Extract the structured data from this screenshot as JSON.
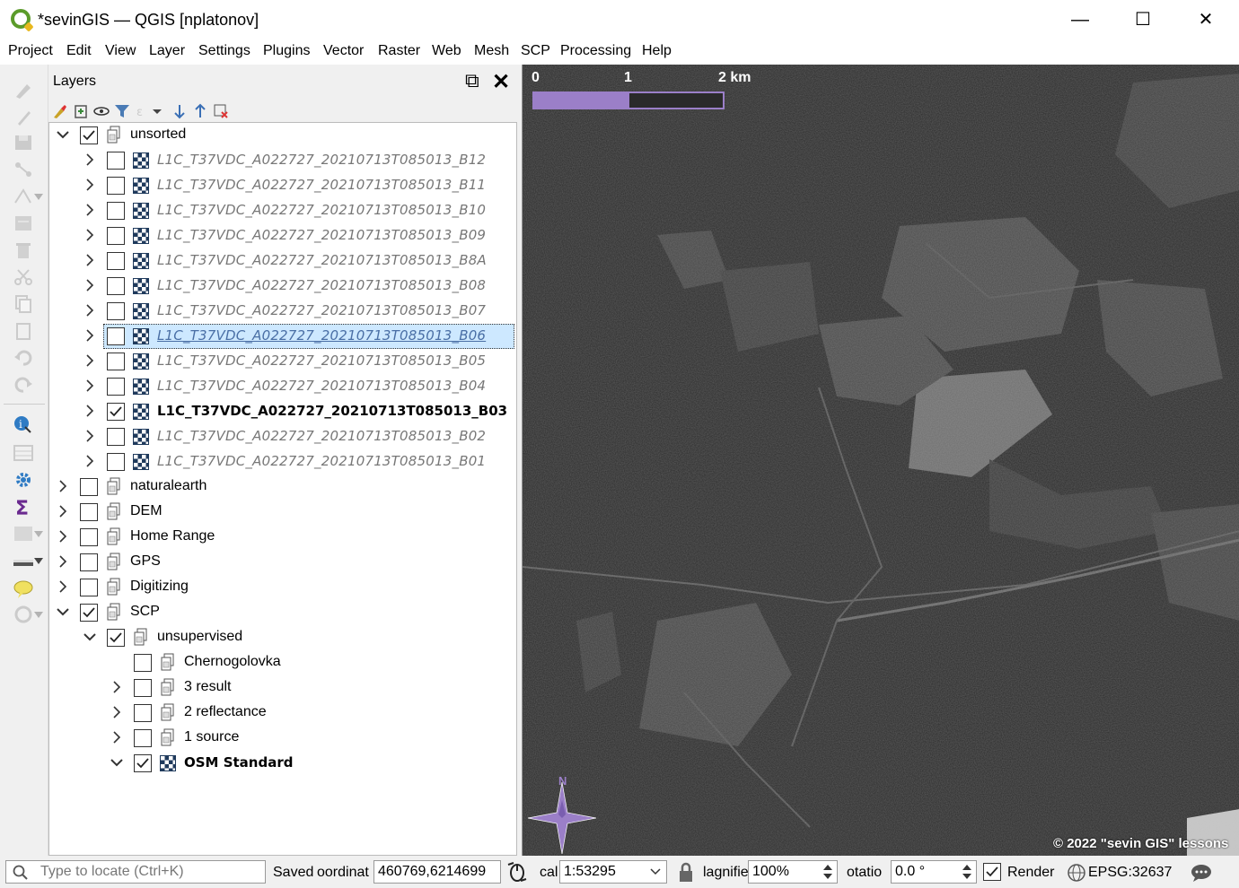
{
  "window": {
    "title": "*sevinGIS — QGIS [nplatonov]",
    "minimize": "—",
    "maximize": "☐",
    "close": "✕"
  },
  "menu": [
    "Project",
    "Edit",
    "View",
    "Layer",
    "Settings",
    "Plugins",
    "Vector",
    "Raster",
    "Web",
    "Mesh",
    "SCP",
    "Processing",
    "Help"
  ],
  "panel": {
    "title": "Layers",
    "float_button": "⧉",
    "close_button": "✕"
  },
  "tree": [
    {
      "label": "unsorted",
      "type": "group",
      "level": 0,
      "expand": "open",
      "checked": true
    },
    {
      "label": "L1C_T37VDC_A022727_20210713T085013_B12",
      "type": "raster",
      "level": 1,
      "expand": "closed",
      "checked": false,
      "style": "it"
    },
    {
      "label": "L1C_T37VDC_A022727_20210713T085013_B11",
      "type": "raster",
      "level": 1,
      "expand": "closed",
      "checked": false,
      "style": "it"
    },
    {
      "label": "L1C_T37VDC_A022727_20210713T085013_B10",
      "type": "raster",
      "level": 1,
      "expand": "closed",
      "checked": false,
      "style": "it"
    },
    {
      "label": "L1C_T37VDC_A022727_20210713T085013_B09",
      "type": "raster",
      "level": 1,
      "expand": "closed",
      "checked": false,
      "style": "it"
    },
    {
      "label": "L1C_T37VDC_A022727_20210713T085013_B8A",
      "type": "raster",
      "level": 1,
      "expand": "closed",
      "checked": false,
      "style": "it"
    },
    {
      "label": "L1C_T37VDC_A022727_20210713T085013_B08",
      "type": "raster",
      "level": 1,
      "expand": "closed",
      "checked": false,
      "style": "it"
    },
    {
      "label": "L1C_T37VDC_A022727_20210713T085013_B07",
      "type": "raster",
      "level": 1,
      "expand": "closed",
      "checked": false,
      "style": "it"
    },
    {
      "label": "L1C_T37VDC_A022727_20210713T085013_B06",
      "type": "raster",
      "level": 1,
      "expand": "closed",
      "checked": false,
      "style": "it",
      "selected": true
    },
    {
      "label": "L1C_T37VDC_A022727_20210713T085013_B05",
      "type": "raster",
      "level": 1,
      "expand": "closed",
      "checked": false,
      "style": "it"
    },
    {
      "label": "L1C_T37VDC_A022727_20210713T085013_B04",
      "type": "raster",
      "level": 1,
      "expand": "closed",
      "checked": false,
      "style": "it"
    },
    {
      "label": "L1C_T37VDC_A022727_20210713T085013_B03",
      "type": "raster",
      "level": 1,
      "expand": "closed",
      "checked": true,
      "style": "bold"
    },
    {
      "label": "L1C_T37VDC_A022727_20210713T085013_B02",
      "type": "raster",
      "level": 1,
      "expand": "closed",
      "checked": false,
      "style": "it"
    },
    {
      "label": "L1C_T37VDC_A022727_20210713T085013_B01",
      "type": "raster",
      "level": 1,
      "expand": "closed",
      "checked": false,
      "style": "it"
    },
    {
      "label": "naturalearth",
      "type": "group",
      "level": 0,
      "expand": "closed",
      "checked": false
    },
    {
      "label": "DEM",
      "type": "group",
      "level": 0,
      "expand": "closed",
      "checked": false
    },
    {
      "label": "Home Range",
      "type": "group",
      "level": 0,
      "expand": "closed",
      "checked": false
    },
    {
      "label": "GPS",
      "type": "group",
      "level": 0,
      "expand": "closed",
      "checked": false
    },
    {
      "label": "Digitizing",
      "type": "group",
      "level": 0,
      "expand": "closed",
      "checked": false
    },
    {
      "label": "SCP",
      "type": "group",
      "level": 0,
      "expand": "open",
      "checked": true
    },
    {
      "label": "unsupervised",
      "type": "group",
      "level": 1,
      "expand": "open",
      "checked": true
    },
    {
      "label": "Chernogolovka",
      "type": "group",
      "level": 2,
      "expand": "none",
      "checked": false
    },
    {
      "label": "3 result",
      "type": "group",
      "level": 2,
      "expand": "closed",
      "checked": false
    },
    {
      "label": "2 reflectance",
      "type": "group",
      "level": 2,
      "expand": "closed",
      "checked": false
    },
    {
      "label": "1 source",
      "type": "group",
      "level": 2,
      "expand": "closed",
      "checked": false
    },
    {
      "label": "OSM Standard",
      "type": "raster",
      "level": 2,
      "expand": "open",
      "checked": true,
      "style": "bold"
    }
  ],
  "map": {
    "scalebar": {
      "label0": "0",
      "label1": "1",
      "label2": "2 km"
    },
    "north": "N",
    "copyright": "© 2022 \"sevin GIS\" lessons"
  },
  "status": {
    "locate_placeholder": "Type to locate (Ctrl+K)",
    "saved": "Saved",
    "coord_label": "oordinat",
    "coord_value": "460769,6214699",
    "scale_label": "cal",
    "scale_value": "1:53295",
    "magnifier_label": "lagnifie",
    "magnifier_value": "100%",
    "rotation_label": "otatio",
    "rotation_value": "0.0 °",
    "render_label": "Render",
    "crs": "EPSG:32637"
  },
  "colors": {
    "accent": "#9b7fc8",
    "scalebar_fill": "#9b7fc8",
    "compass": "#9b7fc8"
  }
}
